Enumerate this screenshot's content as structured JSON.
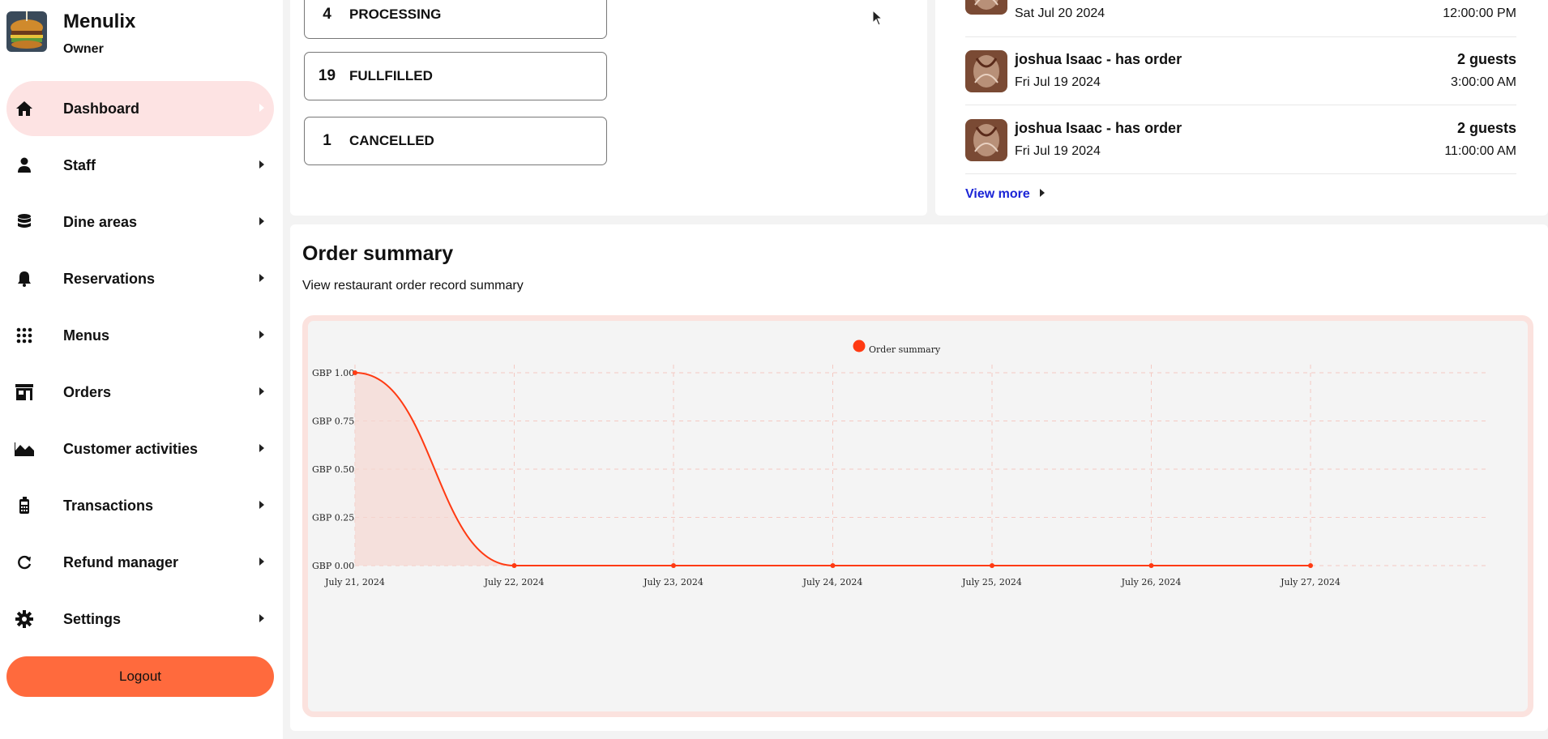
{
  "brand": {
    "name": "Menulix",
    "role": "Owner"
  },
  "sidebar": {
    "items": [
      {
        "label": "Dashboard",
        "icon": "home-icon",
        "active": true
      },
      {
        "label": "Staff",
        "icon": "person-icon"
      },
      {
        "label": "Dine areas",
        "icon": "database-icon"
      },
      {
        "label": "Reservations",
        "icon": "bell-icon"
      },
      {
        "label": "Menus",
        "icon": "grid-icon"
      },
      {
        "label": "Orders",
        "icon": "store-icon"
      },
      {
        "label": "Customer activities",
        "icon": "area-chart-icon"
      },
      {
        "label": "Transactions",
        "icon": "card-reader-icon"
      },
      {
        "label": "Refund manager",
        "icon": "refresh-icon"
      },
      {
        "label": "Settings",
        "icon": "gear-icon"
      }
    ],
    "logout_label": "Logout"
  },
  "order_status": [
    {
      "count": "4",
      "label": "PROCESSING"
    },
    {
      "count": "19",
      "label": "FULLFILLED"
    },
    {
      "count": "1",
      "label": "CANCELLED"
    }
  ],
  "reservations": {
    "rows": [
      {
        "name": "",
        "date": "Sat Jul 20 2024",
        "guests": "",
        "time": "12:00:00 PM"
      },
      {
        "name": "joshua Isaac - has order",
        "date": "Fri Jul 19 2024",
        "guests": "2 guests",
        "time": "3:00:00 AM"
      },
      {
        "name": "joshua Isaac - has order",
        "date": "Fri Jul 19 2024",
        "guests": "2 guests",
        "time": "11:00:00 AM"
      }
    ],
    "view_more_label": "View more"
  },
  "summary": {
    "title": "Order summary",
    "subtitle": "View restaurant order record summary"
  },
  "colors": {
    "accent": "#ff6a3d",
    "series": "#ff3a12",
    "active_nav": "#fde3e3",
    "link": "#1a24d6"
  },
  "chart_data": {
    "type": "area",
    "categories": [
      "July 21, 2024",
      "July 22, 2024",
      "July 23, 2024",
      "July 24, 2024",
      "July 25, 2024",
      "July 26, 2024",
      "July 27, 2024"
    ],
    "series": [
      {
        "name": "Order summary",
        "values": [
          1.0,
          0,
          0,
          0,
          0,
          0,
          0
        ]
      }
    ],
    "yticks": [
      "GBP 0.00",
      "GBP 0.25",
      "GBP 0.50",
      "GBP 0.75",
      "GBP 1.00"
    ],
    "ylim": [
      0,
      1
    ],
    "legend_position": "top-center",
    "grid": true
  }
}
